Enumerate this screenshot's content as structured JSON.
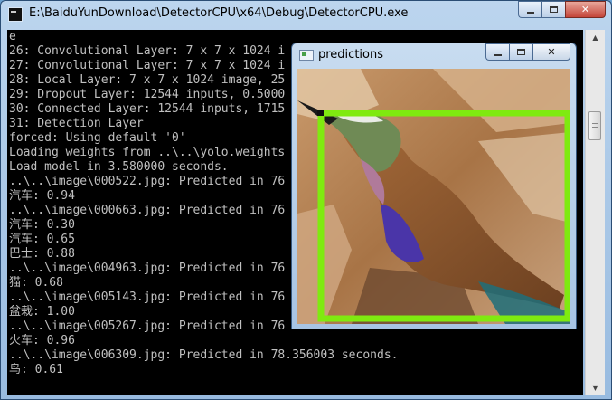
{
  "window": {
    "title": "E:\\BaiduYunDownload\\DetectorCPU\\x64\\Debug\\DetectorCPU.exe",
    "minimize_label": "",
    "maximize_label": "",
    "close_label": "✕"
  },
  "console": {
    "lines": [
      "e",
      "26: Convolutional Layer: 7 x 7 x 1024 i",
      "27: Convolutional Layer: 7 x 7 x 1024 i",
      "28: Local Layer: 7 x 7 x 1024 image, 25",
      "29: Dropout Layer: 12544 inputs, 0.5000",
      "30: Connected Layer: 12544 inputs, 1715",
      "31: Detection Layer",
      "forced: Using default '0'",
      "Loading weights from ..\\..\\yolo.weights",
      "Load model in 3.580000 seconds.",
      "..\\..\\image\\000522.jpg: Predicted in 76",
      "汽车: 0.94",
      "..\\..\\image\\000663.jpg: Predicted in 76",
      "汽车: 0.30",
      "汽车: 0.65",
      "巴士: 0.88",
      "..\\..\\image\\004963.jpg: Predicted in 76",
      "猫: 0.68",
      "..\\..\\image\\005143.jpg: Predicted in 76",
      "盆栽: 1.00",
      "..\\..\\image\\005267.jpg: Predicted in 76",
      "火车: 0.96",
      "..\\..\\image\\006309.jpg: Predicted in 78.356003 seconds.",
      "鸟: 0.61"
    ]
  },
  "predictions": {
    "title": "predictions",
    "close_label": "✕",
    "box_color": "#7fea10"
  },
  "scrollbar": {
    "up_icon": "▲",
    "down_icon": "▼"
  }
}
